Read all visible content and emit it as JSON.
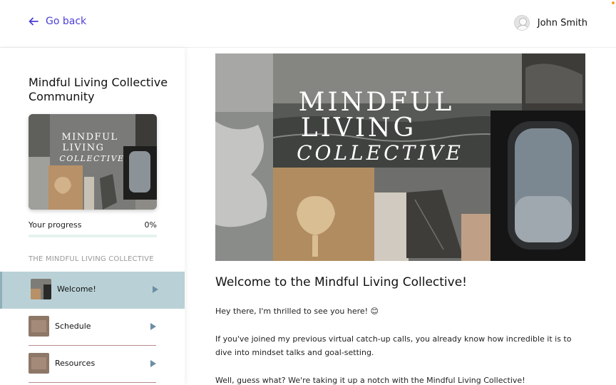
{
  "header": {
    "back_label": "Go back",
    "user_name": "John Smith"
  },
  "sidebar": {
    "course_title": "Mindful Living Collective Community",
    "thumb_text": {
      "line1": "MINDFUL",
      "line2": "LIVING",
      "line3": "COLLECTIVE"
    },
    "progress_label": "Your progress",
    "progress_value": "0%",
    "progress_fraction": 0,
    "section_heading": "THE MINDFUL LIVING COLLECTIVE",
    "lessons": [
      {
        "label": "Welcome!",
        "active": true
      },
      {
        "label": "Schedule",
        "active": false
      },
      {
        "label": "Resources",
        "active": false
      }
    ]
  },
  "main": {
    "hero_text": {
      "line1": "MINDFUL",
      "line2": "LIVING",
      "line3": "COLLECTIVE"
    },
    "title": "Welcome to the Mindful Living Collective!",
    "paragraphs": [
      "Hey there, I'm thrilled to see you here! 😊",
      "If you've joined my previous virtual catch-up calls, you already know how incredible it is to dive into mindset talks and goal-setting.",
      "Well, guess what? We're taking it up a notch with the Mindful Living Collective!"
    ]
  },
  "colors": {
    "accent": "#4b3fd6",
    "active_lesson_bg": "#b9d1d6",
    "progress_track": "#e4f3ec",
    "play_icon": "#6d8fa5"
  }
}
